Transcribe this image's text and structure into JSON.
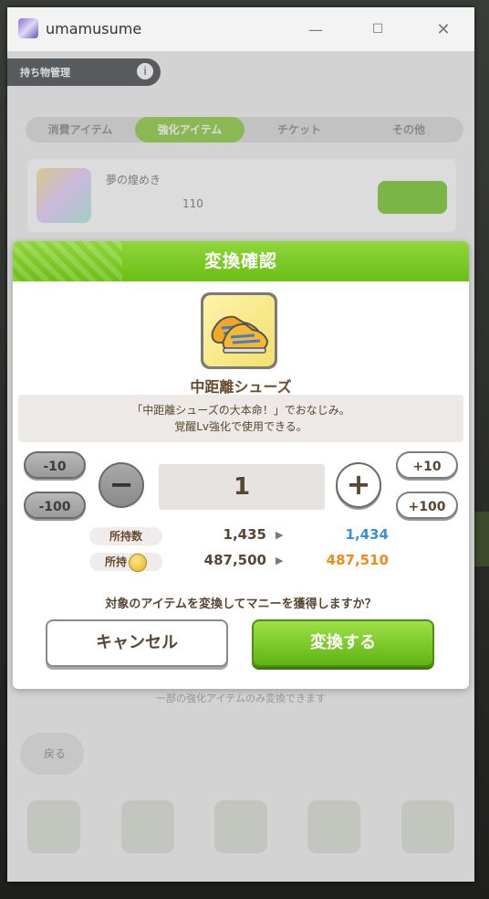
{
  "window": {
    "title": "umamusume",
    "minimize": "—",
    "maximize": "☐",
    "close": "✕"
  },
  "background": {
    "tabs": [
      "消費アイテム",
      "強化アイテム",
      "チケット",
      "その他"
    ],
    "active_tab_index": 1,
    "list_item_qty": "110",
    "back_label": "戻る",
    "footer_note": "一部の強化アイテムのみ変換できます"
  },
  "dialog": {
    "title": "変換確認",
    "item_name": "中距離シューズ",
    "description_line1": "「中距離シューズの大本命！」でおなじみ。",
    "description_line2": "覚醒Lv強化で使用できる。",
    "buttons": {
      "minus10": "-10",
      "minus100": "-100",
      "plus10": "+10",
      "plus100": "+100",
      "decrement": "−",
      "increment": "+"
    },
    "quantity": "1",
    "owned": {
      "label": "所持数",
      "current": "1,435",
      "after": "1,434"
    },
    "money": {
      "label": "所持",
      "current": "487,500",
      "after": "487,510"
    },
    "question": "対象のアイテムを変換してマニーを獲得しますか？",
    "cancel_label": "キャンセル",
    "confirm_label": "変換する"
  },
  "colors": {
    "header_green": "#7dcb28",
    "owned_after_blue": "#3a8fd8",
    "money_after_orange": "#f08a1c",
    "text_brown": "#5a4630"
  }
}
